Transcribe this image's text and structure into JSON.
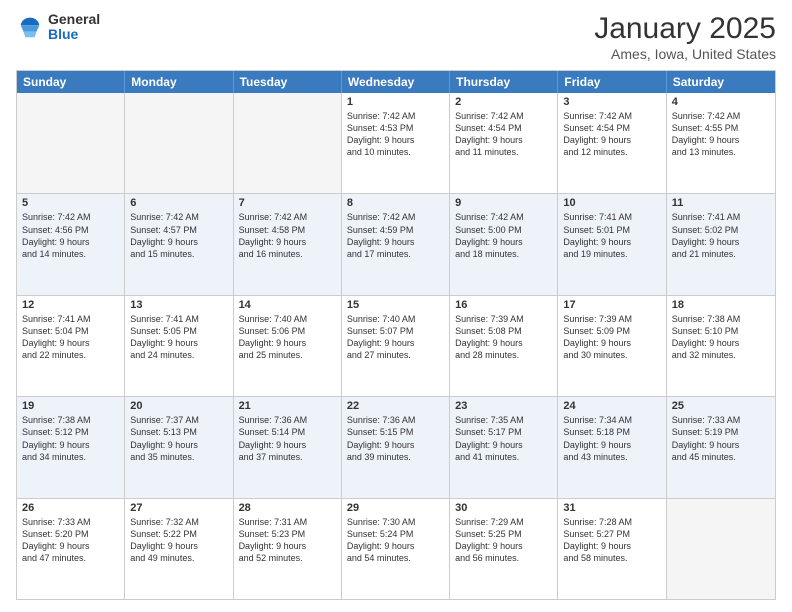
{
  "logo": {
    "general": "General",
    "blue": "Blue"
  },
  "header": {
    "month": "January 2025",
    "location": "Ames, Iowa, United States"
  },
  "weekdays": [
    "Sunday",
    "Monday",
    "Tuesday",
    "Wednesday",
    "Thursday",
    "Friday",
    "Saturday"
  ],
  "rows": [
    [
      {
        "day": "",
        "info": ""
      },
      {
        "day": "",
        "info": ""
      },
      {
        "day": "",
        "info": ""
      },
      {
        "day": "1",
        "info": "Sunrise: 7:42 AM\nSunset: 4:53 PM\nDaylight: 9 hours\nand 10 minutes."
      },
      {
        "day": "2",
        "info": "Sunrise: 7:42 AM\nSunset: 4:54 PM\nDaylight: 9 hours\nand 11 minutes."
      },
      {
        "day": "3",
        "info": "Sunrise: 7:42 AM\nSunset: 4:54 PM\nDaylight: 9 hours\nand 12 minutes."
      },
      {
        "day": "4",
        "info": "Sunrise: 7:42 AM\nSunset: 4:55 PM\nDaylight: 9 hours\nand 13 minutes."
      }
    ],
    [
      {
        "day": "5",
        "info": "Sunrise: 7:42 AM\nSunset: 4:56 PM\nDaylight: 9 hours\nand 14 minutes."
      },
      {
        "day": "6",
        "info": "Sunrise: 7:42 AM\nSunset: 4:57 PM\nDaylight: 9 hours\nand 15 minutes."
      },
      {
        "day": "7",
        "info": "Sunrise: 7:42 AM\nSunset: 4:58 PM\nDaylight: 9 hours\nand 16 minutes."
      },
      {
        "day": "8",
        "info": "Sunrise: 7:42 AM\nSunset: 4:59 PM\nDaylight: 9 hours\nand 17 minutes."
      },
      {
        "day": "9",
        "info": "Sunrise: 7:42 AM\nSunset: 5:00 PM\nDaylight: 9 hours\nand 18 minutes."
      },
      {
        "day": "10",
        "info": "Sunrise: 7:41 AM\nSunset: 5:01 PM\nDaylight: 9 hours\nand 19 minutes."
      },
      {
        "day": "11",
        "info": "Sunrise: 7:41 AM\nSunset: 5:02 PM\nDaylight: 9 hours\nand 21 minutes."
      }
    ],
    [
      {
        "day": "12",
        "info": "Sunrise: 7:41 AM\nSunset: 5:04 PM\nDaylight: 9 hours\nand 22 minutes."
      },
      {
        "day": "13",
        "info": "Sunrise: 7:41 AM\nSunset: 5:05 PM\nDaylight: 9 hours\nand 24 minutes."
      },
      {
        "day": "14",
        "info": "Sunrise: 7:40 AM\nSunset: 5:06 PM\nDaylight: 9 hours\nand 25 minutes."
      },
      {
        "day": "15",
        "info": "Sunrise: 7:40 AM\nSunset: 5:07 PM\nDaylight: 9 hours\nand 27 minutes."
      },
      {
        "day": "16",
        "info": "Sunrise: 7:39 AM\nSunset: 5:08 PM\nDaylight: 9 hours\nand 28 minutes."
      },
      {
        "day": "17",
        "info": "Sunrise: 7:39 AM\nSunset: 5:09 PM\nDaylight: 9 hours\nand 30 minutes."
      },
      {
        "day": "18",
        "info": "Sunrise: 7:38 AM\nSunset: 5:10 PM\nDaylight: 9 hours\nand 32 minutes."
      }
    ],
    [
      {
        "day": "19",
        "info": "Sunrise: 7:38 AM\nSunset: 5:12 PM\nDaylight: 9 hours\nand 34 minutes."
      },
      {
        "day": "20",
        "info": "Sunrise: 7:37 AM\nSunset: 5:13 PM\nDaylight: 9 hours\nand 35 minutes."
      },
      {
        "day": "21",
        "info": "Sunrise: 7:36 AM\nSunset: 5:14 PM\nDaylight: 9 hours\nand 37 minutes."
      },
      {
        "day": "22",
        "info": "Sunrise: 7:36 AM\nSunset: 5:15 PM\nDaylight: 9 hours\nand 39 minutes."
      },
      {
        "day": "23",
        "info": "Sunrise: 7:35 AM\nSunset: 5:17 PM\nDaylight: 9 hours\nand 41 minutes."
      },
      {
        "day": "24",
        "info": "Sunrise: 7:34 AM\nSunset: 5:18 PM\nDaylight: 9 hours\nand 43 minutes."
      },
      {
        "day": "25",
        "info": "Sunrise: 7:33 AM\nSunset: 5:19 PM\nDaylight: 9 hours\nand 45 minutes."
      }
    ],
    [
      {
        "day": "26",
        "info": "Sunrise: 7:33 AM\nSunset: 5:20 PM\nDaylight: 9 hours\nand 47 minutes."
      },
      {
        "day": "27",
        "info": "Sunrise: 7:32 AM\nSunset: 5:22 PM\nDaylight: 9 hours\nand 49 minutes."
      },
      {
        "day": "28",
        "info": "Sunrise: 7:31 AM\nSunset: 5:23 PM\nDaylight: 9 hours\nand 52 minutes."
      },
      {
        "day": "29",
        "info": "Sunrise: 7:30 AM\nSunset: 5:24 PM\nDaylight: 9 hours\nand 54 minutes."
      },
      {
        "day": "30",
        "info": "Sunrise: 7:29 AM\nSunset: 5:25 PM\nDaylight: 9 hours\nand 56 minutes."
      },
      {
        "day": "31",
        "info": "Sunrise: 7:28 AM\nSunset: 5:27 PM\nDaylight: 9 hours\nand 58 minutes."
      },
      {
        "day": "",
        "info": ""
      }
    ]
  ]
}
